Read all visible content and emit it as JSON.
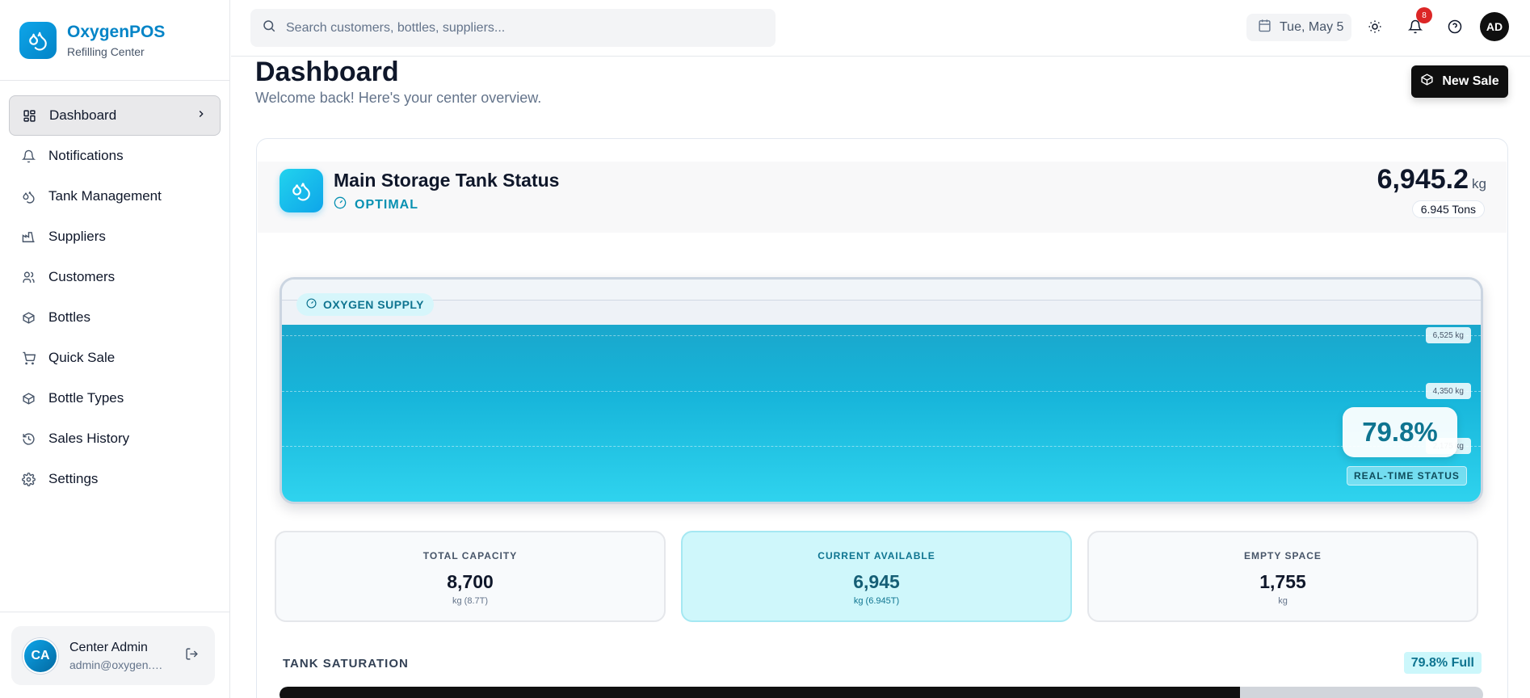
{
  "brand": {
    "name": "OxygenPOS",
    "subtitle": "Refilling Center"
  },
  "sidebar": {
    "items": [
      {
        "label": "Dashboard",
        "icon": "layout-grid-icon",
        "active": true
      },
      {
        "label": "Notifications",
        "icon": "bell-icon"
      },
      {
        "label": "Tank Management",
        "icon": "droplets-icon"
      },
      {
        "label": "Suppliers",
        "icon": "factory-icon"
      },
      {
        "label": "Customers",
        "icon": "users-icon"
      },
      {
        "label": "Bottles",
        "icon": "package-icon"
      },
      {
        "label": "Quick Sale",
        "icon": "cart-icon"
      },
      {
        "label": "Bottle Types",
        "icon": "package-icon"
      },
      {
        "label": "Sales History",
        "icon": "history-icon"
      },
      {
        "label": "Settings",
        "icon": "gear-icon"
      }
    ]
  },
  "user": {
    "initials": "CA",
    "name": "Center Admin",
    "email": "admin@oxygen.c..."
  },
  "topbar": {
    "search_placeholder": "Search customers, bottles, suppliers...",
    "date": "Tue, May 5",
    "notification_count": "8",
    "avatar_initials": "AD"
  },
  "page": {
    "title": "Dashboard",
    "subtitle": "Welcome back! Here's your center overview.",
    "new_sale_label": "New Sale"
  },
  "tank": {
    "title": "Main Storage Tank Status",
    "status": "OPTIMAL",
    "value": "6,945.2",
    "unit": "kg",
    "tons": "6.945 Tons",
    "supply_label": "OXYGEN SUPPLY",
    "fill_fraction": 0.798,
    "gridlines": [
      {
        "label": "6,525 kg",
        "fraction": 0.75
      },
      {
        "label": "4,350 kg",
        "fraction": 0.5
      },
      {
        "label": "2,175 kg",
        "fraction": 0.25
      }
    ],
    "percent": "79.8%",
    "realtime_label": "REAL-TIME STATUS"
  },
  "stats": [
    {
      "label": "TOTAL CAPACITY",
      "value": "8,700",
      "unit": "kg (8.7T)"
    },
    {
      "label": "CURRENT AVAILABLE",
      "value": "6,945",
      "unit": "kg (6.945T)"
    },
    {
      "label": "EMPTY SPACE",
      "value": "1,755",
      "unit": "kg"
    }
  ],
  "saturation": {
    "label": "TANK SATURATION",
    "pill": "79.8% Full",
    "fraction": 0.798
  },
  "colors": {
    "brand": "#0284c7",
    "accent": "#0891b2",
    "alert": "#dc2626"
  }
}
